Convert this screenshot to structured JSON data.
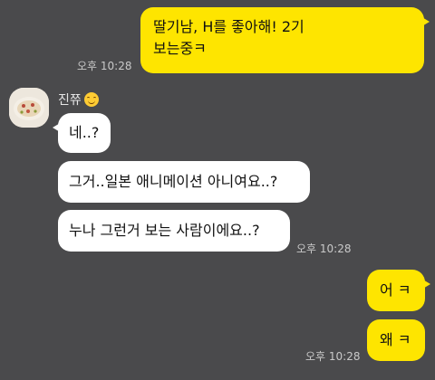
{
  "messages": {
    "m1": {
      "line1": "딸기남, H를 좋아해! 2기",
      "line2": "보는중ㅋ",
      "time": "오후 10:28"
    },
    "sender": {
      "name": "진쮸"
    },
    "m2": {
      "text": "네..?"
    },
    "m3": {
      "text": "그거..일본 애니메이션 아니여요..?"
    },
    "m4": {
      "text": "누나 그런거 보는 사람이에요..?",
      "time": "오후 10:28"
    },
    "m5": {
      "text": "어 ㅋ"
    },
    "m6": {
      "text": "왜 ㅋ",
      "time": "오후 10:28"
    }
  },
  "colors": {
    "background": "#4a4a4c",
    "my_bubble": "#fee500",
    "other_bubble": "#ffffff"
  },
  "icons": {
    "sender_emoji": "smiling-face-emoji-icon",
    "avatar": "profile-photo-food"
  }
}
